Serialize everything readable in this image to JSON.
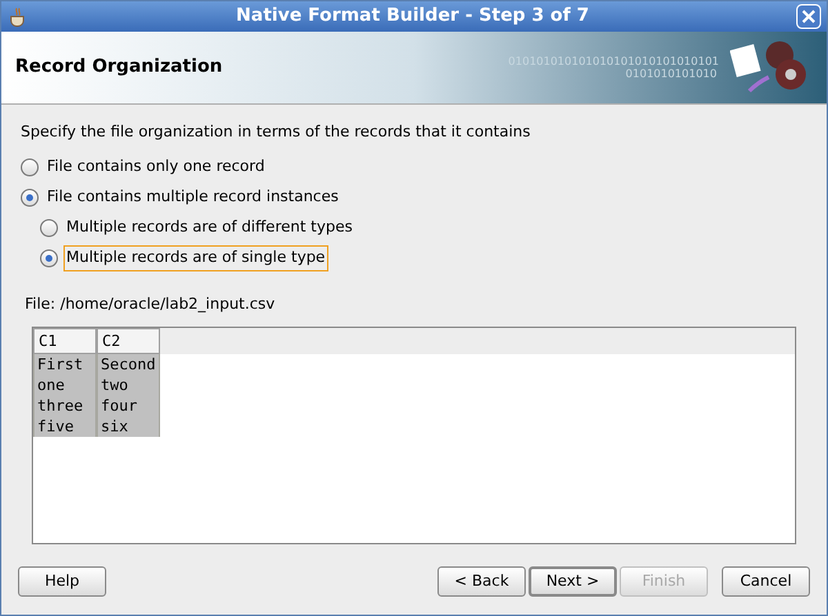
{
  "window": {
    "title": "Native Format Builder - Step 3 of 7"
  },
  "header": {
    "title": "Record Organization",
    "banner_text": [
      "010101010101010101010101010101",
      "0101010101010"
    ]
  },
  "instruction": "Specify the file organization in terms of the records that it contains",
  "options": [
    {
      "label": "File contains only one record",
      "selected": false,
      "focused": false
    },
    {
      "label": "File contains multiple record instances",
      "selected": true,
      "focused": false,
      "children": [
        {
          "label": "Multiple records are of different types",
          "selected": false,
          "focused": false
        },
        {
          "label": "Multiple records are of single type",
          "selected": true,
          "focused": true
        }
      ]
    }
  ],
  "file_label": "File: /home/oracle/lab2_input.csv",
  "table": {
    "columns": [
      "C1",
      "C2"
    ],
    "rows": [
      [
        "First",
        "Second"
      ],
      [
        "one",
        "two"
      ],
      [
        "three",
        "four"
      ],
      [
        "five",
        "six"
      ]
    ]
  },
  "buttons": [
    {
      "label": "Help",
      "kind": "left",
      "disabled": false,
      "default": false
    },
    {
      "label": "< Back",
      "kind": "right",
      "disabled": false,
      "default": false
    },
    {
      "label": "Next >",
      "kind": "right",
      "disabled": false,
      "default": true
    },
    {
      "label": "Finish",
      "kind": "right",
      "disabled": true,
      "default": false
    },
    {
      "label": "Cancel",
      "kind": "right",
      "disabled": false,
      "default": false
    }
  ]
}
